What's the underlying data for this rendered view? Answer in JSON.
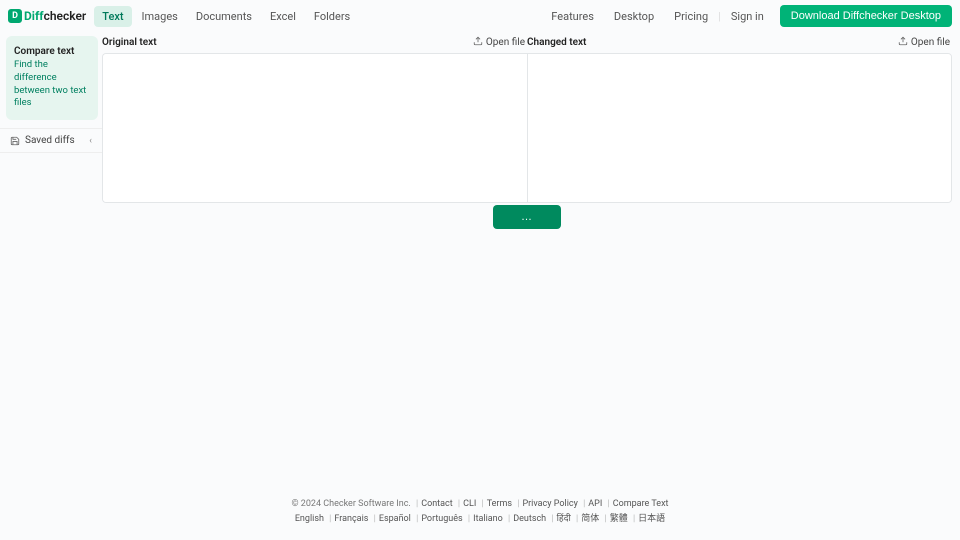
{
  "logo": {
    "diff": "Diff",
    "checker": "checker"
  },
  "nav": {
    "items": [
      "Text",
      "Images",
      "Documents",
      "Excel",
      "Folders"
    ],
    "activeIndex": 0
  },
  "headerLinks": {
    "features": "Features",
    "desktop": "Desktop",
    "pricing": "Pricing",
    "signin": "Sign in",
    "download": "Download Diffchecker Desktop"
  },
  "sidebar": {
    "title": "Compare text",
    "desc": "Find the difference between two text files",
    "savedDiffs": "Saved diffs"
  },
  "diff": {
    "originalLabel": "Original text",
    "changedLabel": "Changed text",
    "openFile": "Open file",
    "originalValue": "",
    "changedValue": "",
    "findButton": "…"
  },
  "footer": {
    "copyright": "© 2024 Checker Software Inc.",
    "links": [
      "Contact",
      "CLI",
      "Terms",
      "Privacy Policy",
      "API",
      "Compare Text"
    ],
    "langs": [
      "English",
      "Français",
      "Español",
      "Português",
      "Italiano",
      "Deutsch",
      "हिंदी",
      "简体",
      "繁體",
      "日本語"
    ]
  }
}
